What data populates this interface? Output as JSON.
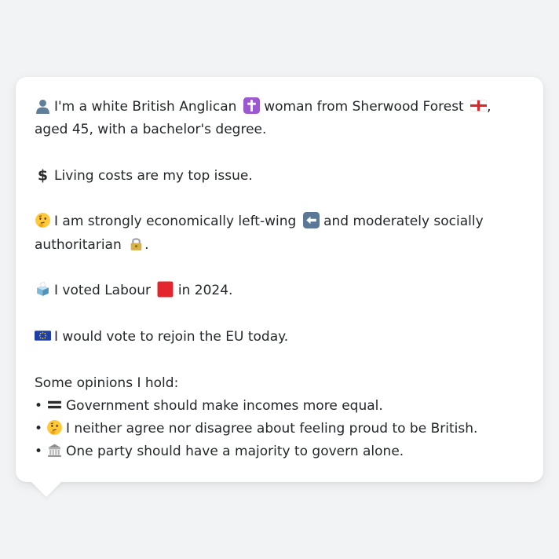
{
  "profile": {
    "line1_prefix": "I'm a white British Anglican",
    "line1_middle": "woman from Sherwood Forest",
    "line1_suffix": ", aged 45, with a bachelor's degree.",
    "issue": "Living costs are my top issue.",
    "ideology_part1": "I am strongly economically left-wing",
    "ideology_part2": "and moderately socially authoritarian",
    "ideology_end": ".",
    "vote_part1": "I voted Labour",
    "vote_part2": "in 2024.",
    "eu": "I would vote to rejoin the EU today."
  },
  "opinions": {
    "heading": "Some opinions I hold:",
    "bullet": "•",
    "items": [
      {
        "text": "Government should make incomes more equal.",
        "icon": "equals-icon"
      },
      {
        "text": "I neither agree nor disagree about feeling proud to be British.",
        "icon": "thinking-face-icon"
      },
      {
        "text": "One party should have a majority to govern alone.",
        "icon": "classical-building-icon"
      }
    ]
  },
  "icons": {
    "person": "bust-silhouette-icon",
    "cross": "latin-cross-icon",
    "flag": "england-flag-icon",
    "money": "dollar-sign-icon",
    "thinking": "thinking-face-icon",
    "left_arrow": "left-arrow-icon",
    "lock": "lock-icon",
    "ballot": "ballot-box-icon",
    "labour": "red-square-icon",
    "eu": "eu-flag-icon"
  },
  "colors": {
    "background": "#f2f3f5",
    "card": "#ffffff",
    "text": "#23262b",
    "labour_red": "#e3262d",
    "cross_purple": "#9b59d0",
    "eu_blue": "#1f3fa8",
    "eu_star": "#ffd400"
  }
}
